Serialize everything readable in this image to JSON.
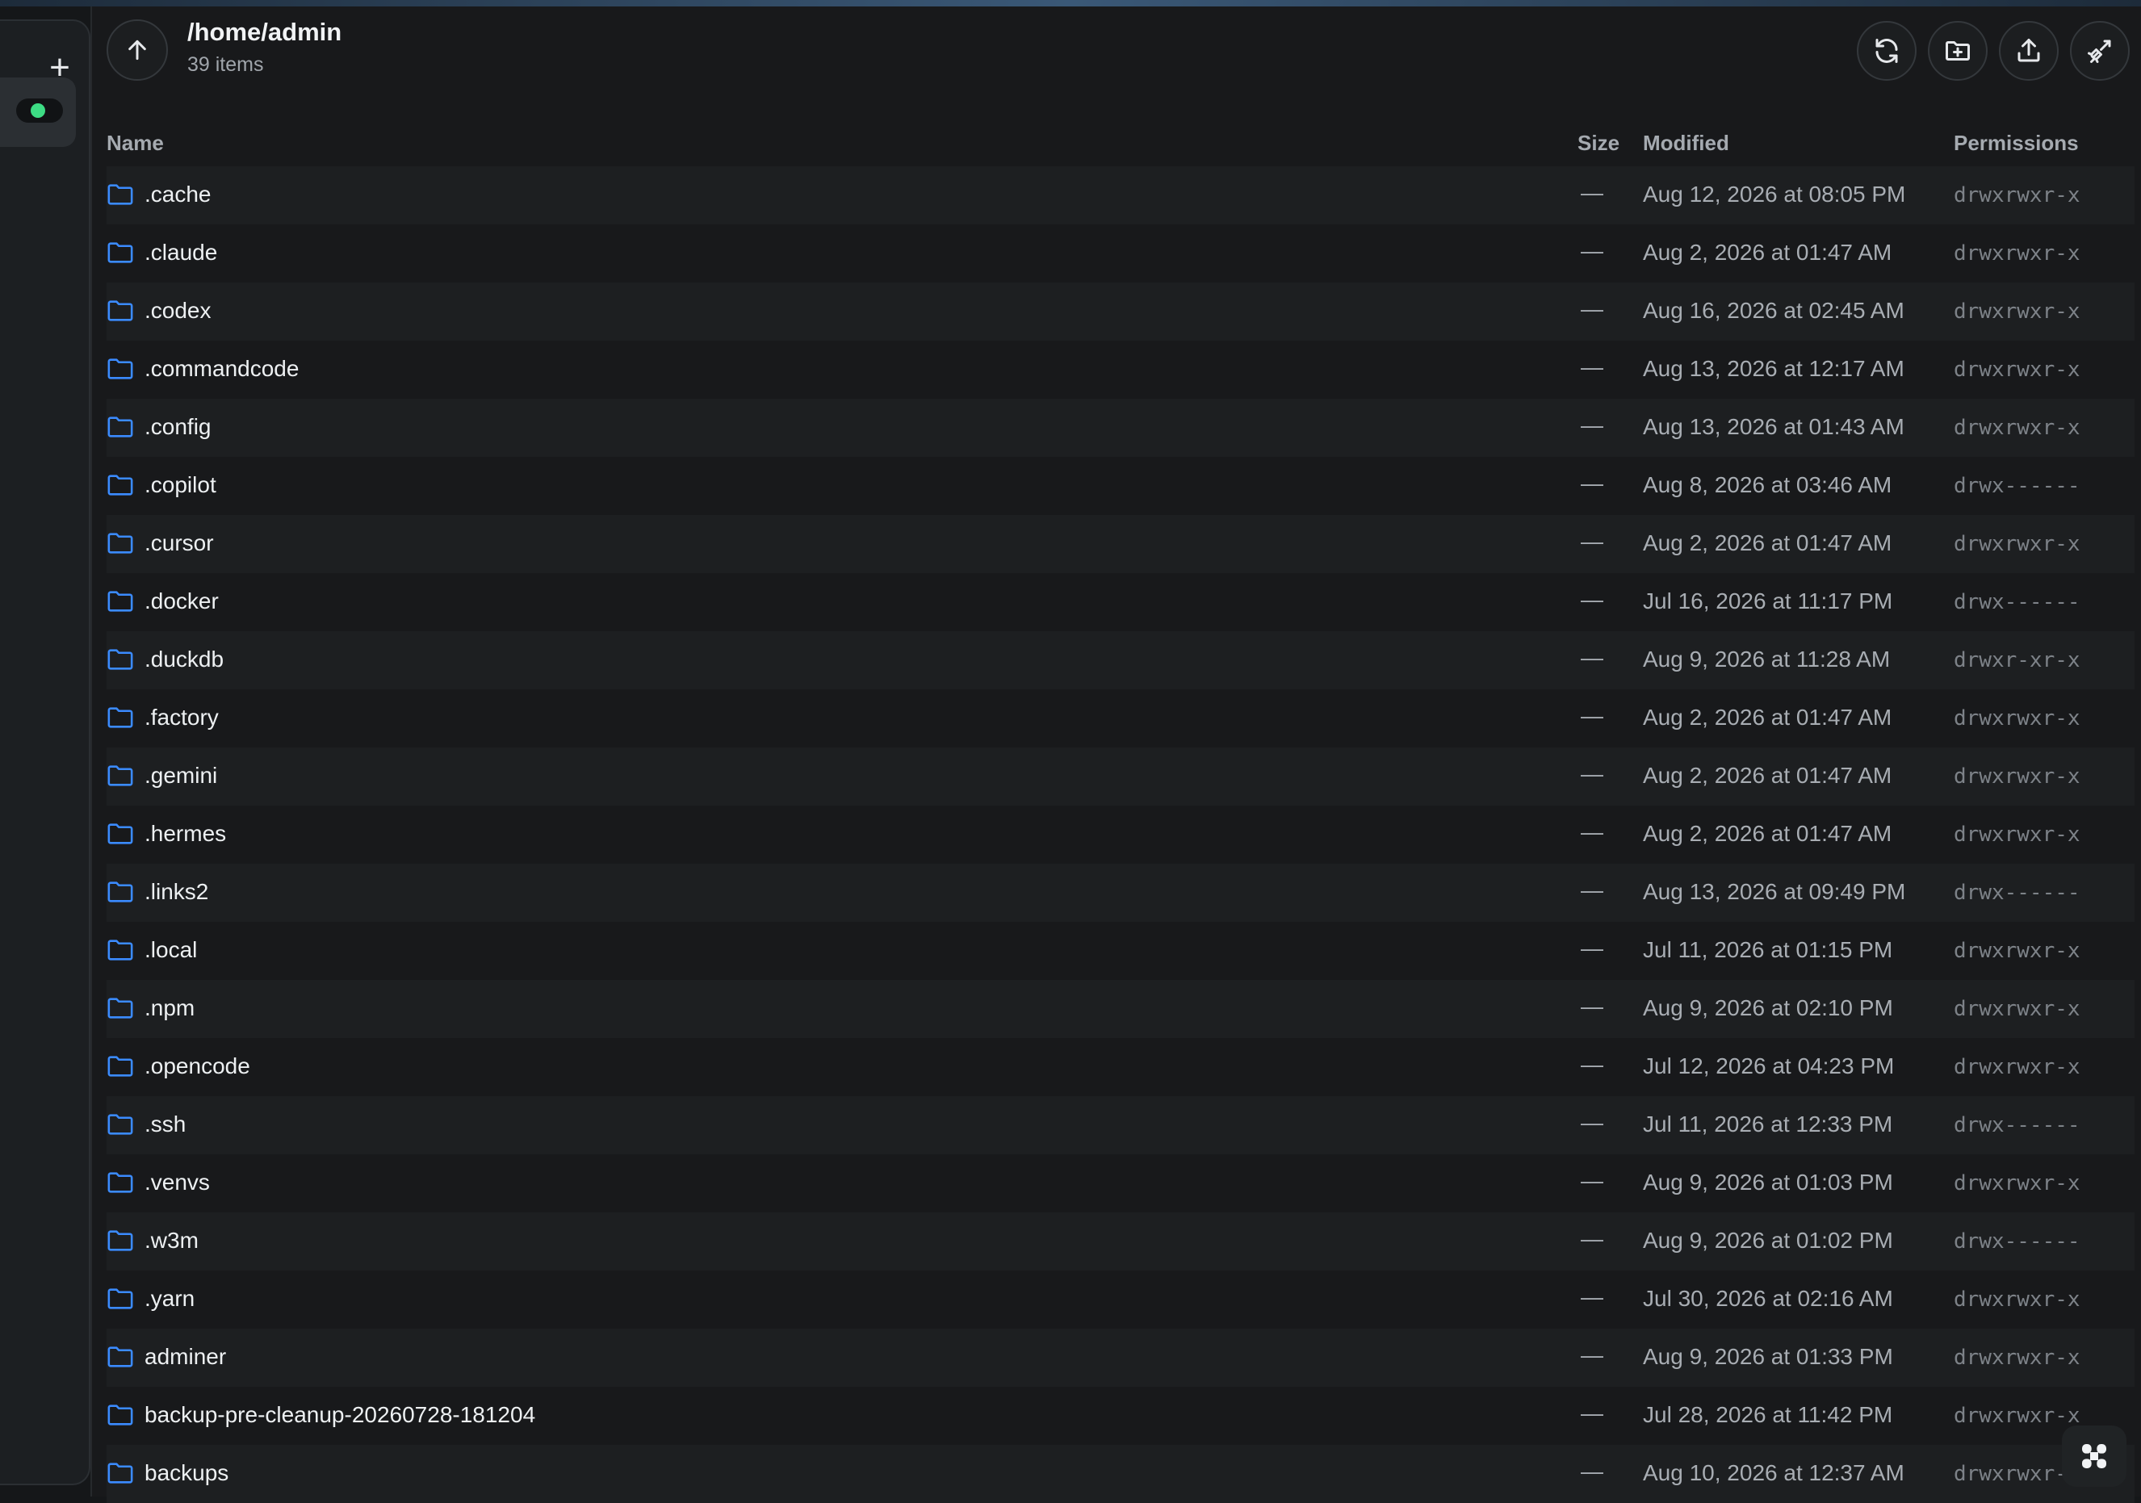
{
  "rail": {
    "add_icon": "plus-icon",
    "status_color": "#3ddc84"
  },
  "header": {
    "path": "/home/admin",
    "item_count": "39 items",
    "up_icon": "arrow-up-icon",
    "tools": [
      "refresh-icon",
      "new-folder-icon",
      "upload-icon",
      "disconnect-icon"
    ]
  },
  "table": {
    "columns": {
      "name": "Name",
      "size": "Size",
      "modified": "Modified",
      "permissions": "Permissions"
    },
    "rows": [
      {
        "name": ".cache",
        "size": "—",
        "modified": "Aug 12, 2026 at 08:05 PM",
        "permissions": "drwxrwxr-x"
      },
      {
        "name": ".claude",
        "size": "—",
        "modified": "Aug 2, 2026 at 01:47 AM",
        "permissions": "drwxrwxr-x"
      },
      {
        "name": ".codex",
        "size": "—",
        "modified": "Aug 16, 2026 at 02:45 AM",
        "permissions": "drwxrwxr-x"
      },
      {
        "name": ".commandcode",
        "size": "—",
        "modified": "Aug 13, 2026 at 12:17 AM",
        "permissions": "drwxrwxr-x"
      },
      {
        "name": ".config",
        "size": "—",
        "modified": "Aug 13, 2026 at 01:43 AM",
        "permissions": "drwxrwxr-x"
      },
      {
        "name": ".copilot",
        "size": "—",
        "modified": "Aug 8, 2026 at 03:46 AM",
        "permissions": "drwx------"
      },
      {
        "name": ".cursor",
        "size": "—",
        "modified": "Aug 2, 2026 at 01:47 AM",
        "permissions": "drwxrwxr-x"
      },
      {
        "name": ".docker",
        "size": "—",
        "modified": "Jul 16, 2026 at 11:17 PM",
        "permissions": "drwx------"
      },
      {
        "name": ".duckdb",
        "size": "—",
        "modified": "Aug 9, 2026 at 11:28 AM",
        "permissions": "drwxr-xr-x"
      },
      {
        "name": ".factory",
        "size": "—",
        "modified": "Aug 2, 2026 at 01:47 AM",
        "permissions": "drwxrwxr-x"
      },
      {
        "name": ".gemini",
        "size": "—",
        "modified": "Aug 2, 2026 at 01:47 AM",
        "permissions": "drwxrwxr-x"
      },
      {
        "name": ".hermes",
        "size": "—",
        "modified": "Aug 2, 2026 at 01:47 AM",
        "permissions": "drwxrwxr-x"
      },
      {
        "name": ".links2",
        "size": "—",
        "modified": "Aug 13, 2026 at 09:49 PM",
        "permissions": "drwx------"
      },
      {
        "name": ".local",
        "size": "—",
        "modified": "Jul 11, 2026 at 01:15 PM",
        "permissions": "drwxrwxr-x"
      },
      {
        "name": ".npm",
        "size": "—",
        "modified": "Aug 9, 2026 at 02:10 PM",
        "permissions": "drwxrwxr-x"
      },
      {
        "name": ".opencode",
        "size": "—",
        "modified": "Jul 12, 2026 at 04:23 PM",
        "permissions": "drwxrwxr-x"
      },
      {
        "name": ".ssh",
        "size": "—",
        "modified": "Jul 11, 2026 at 12:33 PM",
        "permissions": "drwx------"
      },
      {
        "name": ".venvs",
        "size": "—",
        "modified": "Aug 9, 2026 at 01:03 PM",
        "permissions": "drwxrwxr-x"
      },
      {
        "name": ".w3m",
        "size": "—",
        "modified": "Aug 9, 2026 at 01:02 PM",
        "permissions": "drwx------"
      },
      {
        "name": ".yarn",
        "size": "—",
        "modified": "Jul 30, 2026 at 02:16 AM",
        "permissions": "drwxrwxr-x"
      },
      {
        "name": "adminer",
        "size": "—",
        "modified": "Aug 9, 2026 at 01:33 PM",
        "permissions": "drwxrwxr-x"
      },
      {
        "name": "backup-pre-cleanup-20260728-181204",
        "size": "—",
        "modified": "Jul 28, 2026 at 11:42 PM",
        "permissions": "drwxrwxr-x"
      },
      {
        "name": "backups",
        "size": "—",
        "modified": "Aug 10, 2026 at 12:37 AM",
        "permissions": "drwxrwxr-x"
      }
    ]
  },
  "fab": {
    "icon": "app-grid-icon"
  },
  "colors": {
    "accent": "#3b8bff",
    "background": "#18191b",
    "row_alt": "#1d1f21"
  }
}
